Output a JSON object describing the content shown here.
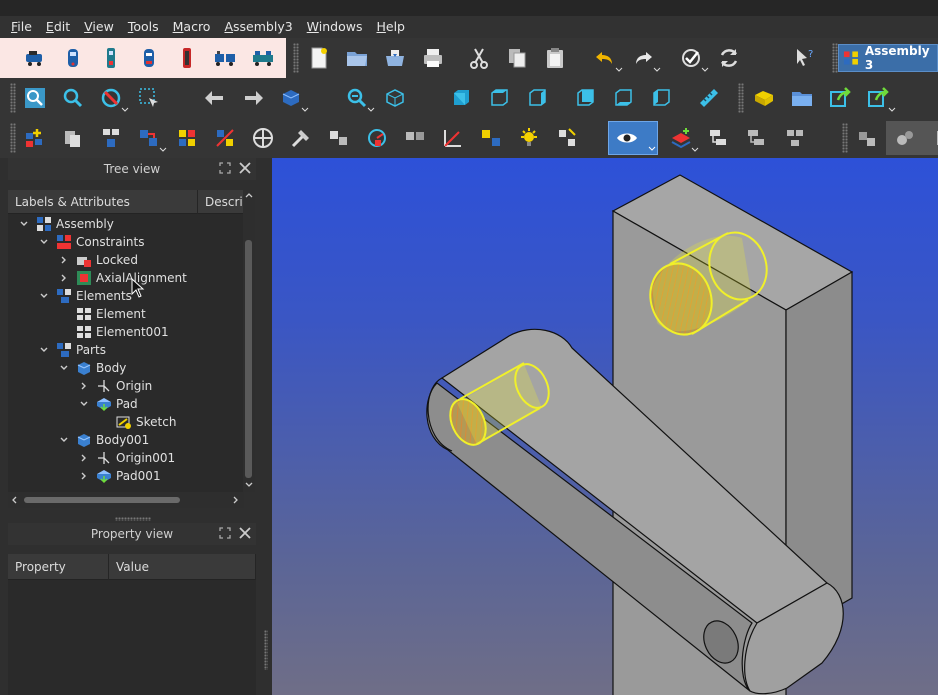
{
  "menu": [
    {
      "label": "File",
      "u": "F",
      "rest": "ile"
    },
    {
      "label": "Edit",
      "u": "E",
      "rest": "dit"
    },
    {
      "label": "View",
      "u": "V",
      "rest": "iew"
    },
    {
      "label": "Tools",
      "u": "T",
      "rest": "ools"
    },
    {
      "label": "Macro",
      "u": "M",
      "rest": "acro"
    },
    {
      "label": "Assembly3",
      "u": "A",
      "rest": "ssembly3"
    },
    {
      "label": "Windows",
      "u": "W",
      "rest": "indows"
    },
    {
      "label": "Help",
      "u": "H",
      "rest": "elp"
    }
  ],
  "workbench": {
    "label": "Assembly 3"
  },
  "tree_view": {
    "title": "Tree view",
    "columns": [
      "Labels & Attributes",
      "Descrip"
    ],
    "items": [
      {
        "label": "Assembly",
        "depth": 1,
        "icon": "assembly-icon",
        "expander": "expanded"
      },
      {
        "label": "Constraints",
        "depth": 2,
        "icon": "constraints-icon",
        "expander": "expanded"
      },
      {
        "label": "Locked",
        "depth": 3,
        "icon": "lock-constraint-icon",
        "expander": "collapsed"
      },
      {
        "label": "AxialAlignment",
        "depth": 3,
        "icon": "axial-alignment-icon",
        "expander": "collapsed"
      },
      {
        "label": "Elements",
        "depth": 2,
        "icon": "elements-icon",
        "expander": "expanded"
      },
      {
        "label": "Element",
        "depth": 3,
        "icon": "element-icon",
        "expander": "none"
      },
      {
        "label": "Element001",
        "depth": 3,
        "icon": "element-icon",
        "expander": "none"
      },
      {
        "label": "Parts",
        "depth": 2,
        "icon": "parts-icon",
        "expander": "expanded"
      },
      {
        "label": "Body",
        "depth": 3,
        "icon": "body-icon",
        "expander": "expanded"
      },
      {
        "label": "Origin",
        "depth": 4,
        "icon": "origin-icon",
        "expander": "collapsed"
      },
      {
        "label": "Pad",
        "depth": 4,
        "icon": "pad-icon",
        "expander": "expanded"
      },
      {
        "label": "Sketch",
        "depth": 5,
        "icon": "sketch-icon",
        "expander": "none"
      },
      {
        "label": "Body001",
        "depth": 3,
        "icon": "body-icon",
        "expander": "expanded"
      },
      {
        "label": "Origin001",
        "depth": 4,
        "icon": "origin-icon",
        "expander": "collapsed"
      },
      {
        "label": "Pad001",
        "depth": 4,
        "icon": "pad-icon",
        "expander": "collapsed"
      }
    ]
  },
  "property_view": {
    "title": "Property view",
    "columns": [
      "Property",
      "Value"
    ]
  },
  "colors": {
    "highlight_yellow": "#f0f02a",
    "part_gray": "#a6a6a6",
    "view_top": "#2d51d8",
    "view_bottom": "#6f6e87",
    "workbench_accent": "#3b6ea8"
  }
}
